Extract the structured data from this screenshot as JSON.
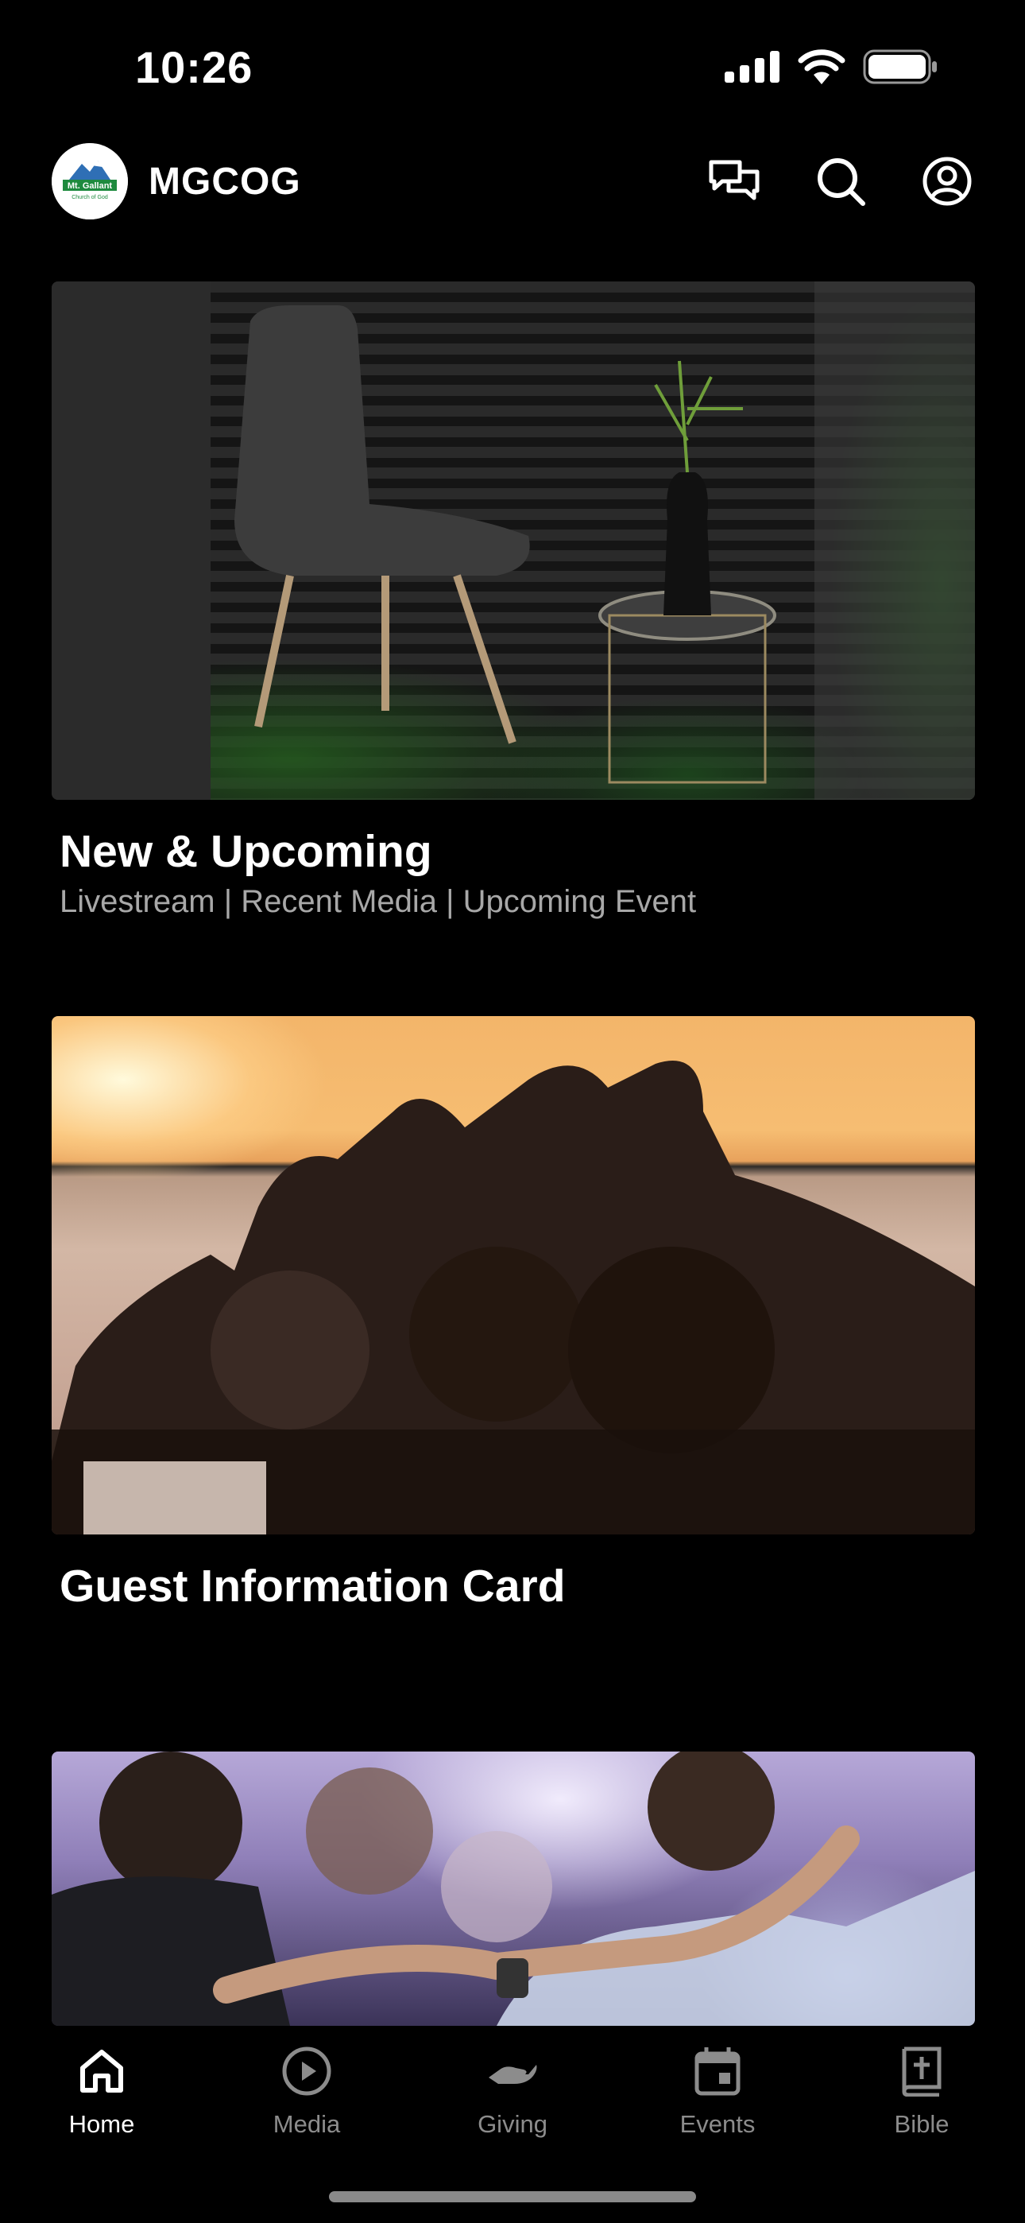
{
  "status": {
    "time": "10:26",
    "icons": [
      "cellular-signal-icon",
      "wifi-icon",
      "battery-icon"
    ]
  },
  "header": {
    "logo_text_line1": "Mt. Gallant",
    "logo_text_line2": "Church of God",
    "title": "MGCOG",
    "actions": [
      "chat-icon",
      "search-icon",
      "profile-icon"
    ]
  },
  "cards": [
    {
      "title": "New & Upcoming",
      "subtitle": "Livestream | Recent Media | Upcoming Event",
      "image": "chair-and-vase-photo"
    },
    {
      "title": "Guest Information Card",
      "subtitle": "",
      "image": "sunset-heart-hands-photo"
    },
    {
      "title": "",
      "subtitle": "",
      "image": "worship-group-photo"
    }
  ],
  "tabs": [
    {
      "label": "Home",
      "icon": "home-icon",
      "active": true
    },
    {
      "label": "Media",
      "icon": "play-circle-icon",
      "active": false
    },
    {
      "label": "Giving",
      "icon": "giving-hand-icon",
      "active": false
    },
    {
      "label": "Events",
      "icon": "calendar-icon",
      "active": false
    },
    {
      "label": "Bible",
      "icon": "bible-icon",
      "active": false
    }
  ],
  "colors": {
    "background": "#000000",
    "text_primary": "#ffffff",
    "text_secondary": "#a8a8a8",
    "tab_inactive": "#8c8c8c",
    "logo_green": "#1e8a3e",
    "logo_blue": "#2f6fb5"
  }
}
